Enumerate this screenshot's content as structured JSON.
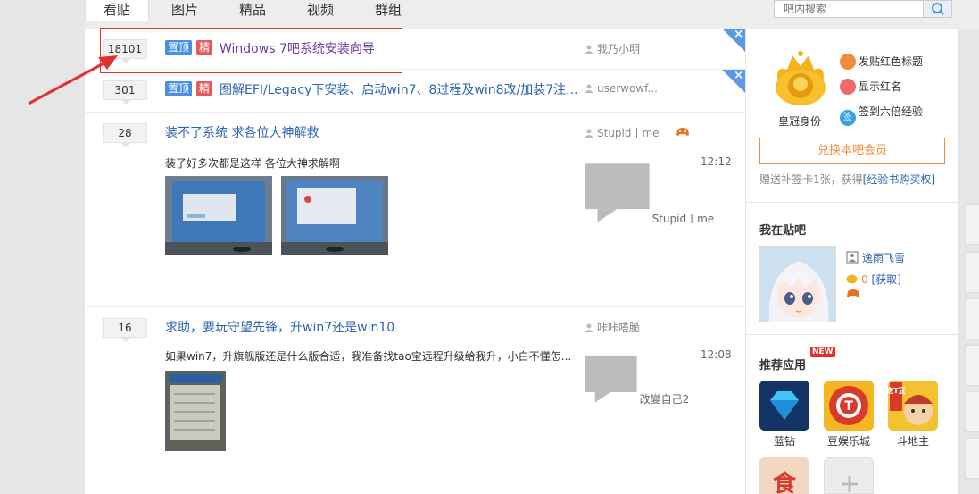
{
  "tabs": [
    {
      "label": "看贴",
      "active": true
    },
    {
      "label": "图片",
      "active": false
    },
    {
      "label": "精品",
      "active": false
    },
    {
      "label": "视频",
      "active": false
    },
    {
      "label": "群组",
      "active": false
    }
  ],
  "search": {
    "placeholder": "吧内搜索"
  },
  "threads": [
    {
      "replies": "18101",
      "badges": [
        "置顶",
        "精"
      ],
      "title": "Windows 7吧系统安装向导",
      "author": "我乃小明"
    },
    {
      "replies": "301",
      "badges": [
        "置顶",
        "精"
      ],
      "title": "图解EFI/Legacy下安装、启动win7、8过程及win8改/加装7注...",
      "author": "userwowf..."
    },
    {
      "replies": "28",
      "title": "装不了系统 求各位大神解救",
      "author": "Stupid丨me",
      "abstract": "装了好多次都是这样 各位大神求解啊",
      "last_reply": "Stupid丨me",
      "time": "12:12"
    },
    {
      "replies": "16",
      "title": "求助，要玩守望先锋，升win7还是win10",
      "author": "咔咔嗒脆",
      "abstract": "如果win7，升旗舰版还是什么版合适，我准备找tao宝远程升级给我升，小白不懂怎...",
      "last_reply": "改變自己2",
      "time": "12:08"
    }
  ],
  "sidebar": {
    "crown_label": "皇冠身份",
    "perks": [
      "发贴红色标题",
      "显示红名",
      "签到六倍经验"
    ],
    "perk_sign_glyph": "签",
    "vip_button": "兑换本吧会员",
    "gift_text": "赠送补签卡1张，获得",
    "gift_link": "[经验书购买权]",
    "my_bar_title": "我在贴吧",
    "username": "逸雨飞雪",
    "coins": "0",
    "coins_link": "[获取]",
    "apps_title": "推荐应用",
    "new_badge": "NEW",
    "apps": [
      "蓝钻",
      "豆娱乐城",
      "斗地主"
    ],
    "app_icon_glyphs": {
      "yule": "T",
      "doudizhu_top": "送T豆",
      "shi": "食"
    }
  },
  "colors": {
    "link": "#2d64b3",
    "badge_top": "#4a90e2",
    "badge_good": "#e85a5a",
    "accent": "#f08a3c",
    "highlight_box": "#e03030"
  }
}
